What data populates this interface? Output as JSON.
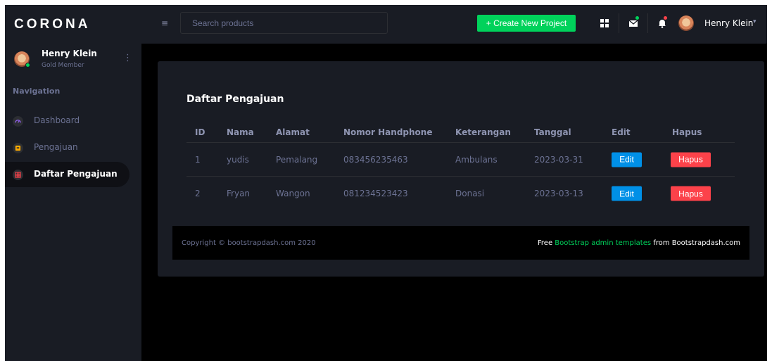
{
  "brand": "CORONA",
  "colors": {
    "accent_green": "#00d25b",
    "primary_blue": "#0090e7",
    "danger_red": "#fc424a",
    "sidebar_bg": "#191c24",
    "page_bg": "#000000",
    "muted_text": "#6c7293"
  },
  "profile": {
    "name": "Henry Klein",
    "role": "Gold Member",
    "menu_icon": "vertical-dots-icon"
  },
  "sidebar": {
    "title": "Navigation",
    "items": [
      {
        "label": "Dashboard",
        "icon": "speedometer-icon",
        "icon_color": "#8f5fe8",
        "active": false
      },
      {
        "label": "Pengajuan",
        "icon": "document-icon",
        "icon_color": "#ffab00",
        "active": false
      },
      {
        "label": "Daftar Pengajuan",
        "icon": "table-icon",
        "icon_color": "#fc424a",
        "active": true
      }
    ]
  },
  "topbar": {
    "menu_icon": "hamburger-icon",
    "search_placeholder": "Search products",
    "create_label": "+ Create New Project",
    "icons": [
      "grid-icon",
      "mail-icon",
      "bell-icon"
    ],
    "user_name": "Henry Klein",
    "caret": "▾"
  },
  "card": {
    "title": "Daftar Pengajuan",
    "columns": [
      "ID",
      "Nama",
      "Alamat",
      "Nomor Handphone",
      "Keterangan",
      "Tanggal",
      "Edit",
      "Hapus"
    ],
    "rows": [
      {
        "id": "1",
        "nama": "yudis",
        "alamat": "Pemalang",
        "nomor": "083456235463",
        "keterangan": "Ambulans",
        "tanggal": "2023-03-31",
        "edit": "Edit",
        "hapus": "Hapus"
      },
      {
        "id": "2",
        "nama": "Fryan",
        "alamat": "Wangon",
        "nomor": "081234523423",
        "keterangan": "Donasi",
        "tanggal": "2023-03-13",
        "edit": "Edit",
        "hapus": "Hapus"
      }
    ]
  },
  "footer": {
    "copyright": "Copyright © bootstrapdash.com 2020",
    "right_prefix": "Free ",
    "right_link": "Bootstrap admin templates",
    "right_suffix": " from Bootstrapdash.com"
  }
}
